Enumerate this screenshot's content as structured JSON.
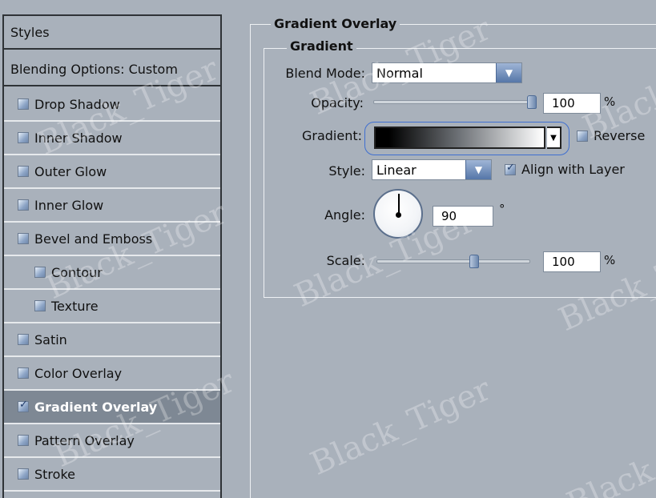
{
  "sidebar": {
    "header": "Styles",
    "blending": "Blending Options: Custom",
    "items": [
      {
        "label": "Drop Shadow",
        "checked": false
      },
      {
        "label": "Inner Shadow",
        "checked": false
      },
      {
        "label": "Outer Glow",
        "checked": false
      },
      {
        "label": "Inner Glow",
        "checked": false
      },
      {
        "label": "Bevel and Emboss",
        "checked": false
      },
      {
        "label": "Contour",
        "checked": false
      },
      {
        "label": "Texture",
        "checked": false
      },
      {
        "label": "Satin",
        "checked": false
      },
      {
        "label": "Color Overlay",
        "checked": false
      },
      {
        "label": "Gradient Overlay",
        "checked": true
      },
      {
        "label": "Pattern Overlay",
        "checked": false
      },
      {
        "label": "Stroke",
        "checked": false
      }
    ]
  },
  "panel": {
    "section_title": "Gradient Overlay",
    "group_title": "Gradient",
    "blend_mode": {
      "label": "Blend Mode:",
      "value": "Normal"
    },
    "opacity": {
      "label": "Opacity:",
      "value": "100",
      "unit": "%",
      "level": 100
    },
    "gradient": {
      "label": "Gradient:",
      "reverse_label": "Reverse",
      "reverse_checked": false
    },
    "style": {
      "label": "Style:",
      "value": "Linear",
      "align_label": "Align with Layer",
      "align_checked": true
    },
    "angle": {
      "label": "Angle:",
      "value": "90",
      "unit": "°"
    },
    "scale": {
      "label": "Scale:",
      "value": "100",
      "unit": "%",
      "level": 100
    }
  },
  "watermark": "Black_Tiger",
  "colors": {
    "panel_bg": "#a9b1bb",
    "selected_row": "#7e8894",
    "accent": "#5576a8"
  }
}
